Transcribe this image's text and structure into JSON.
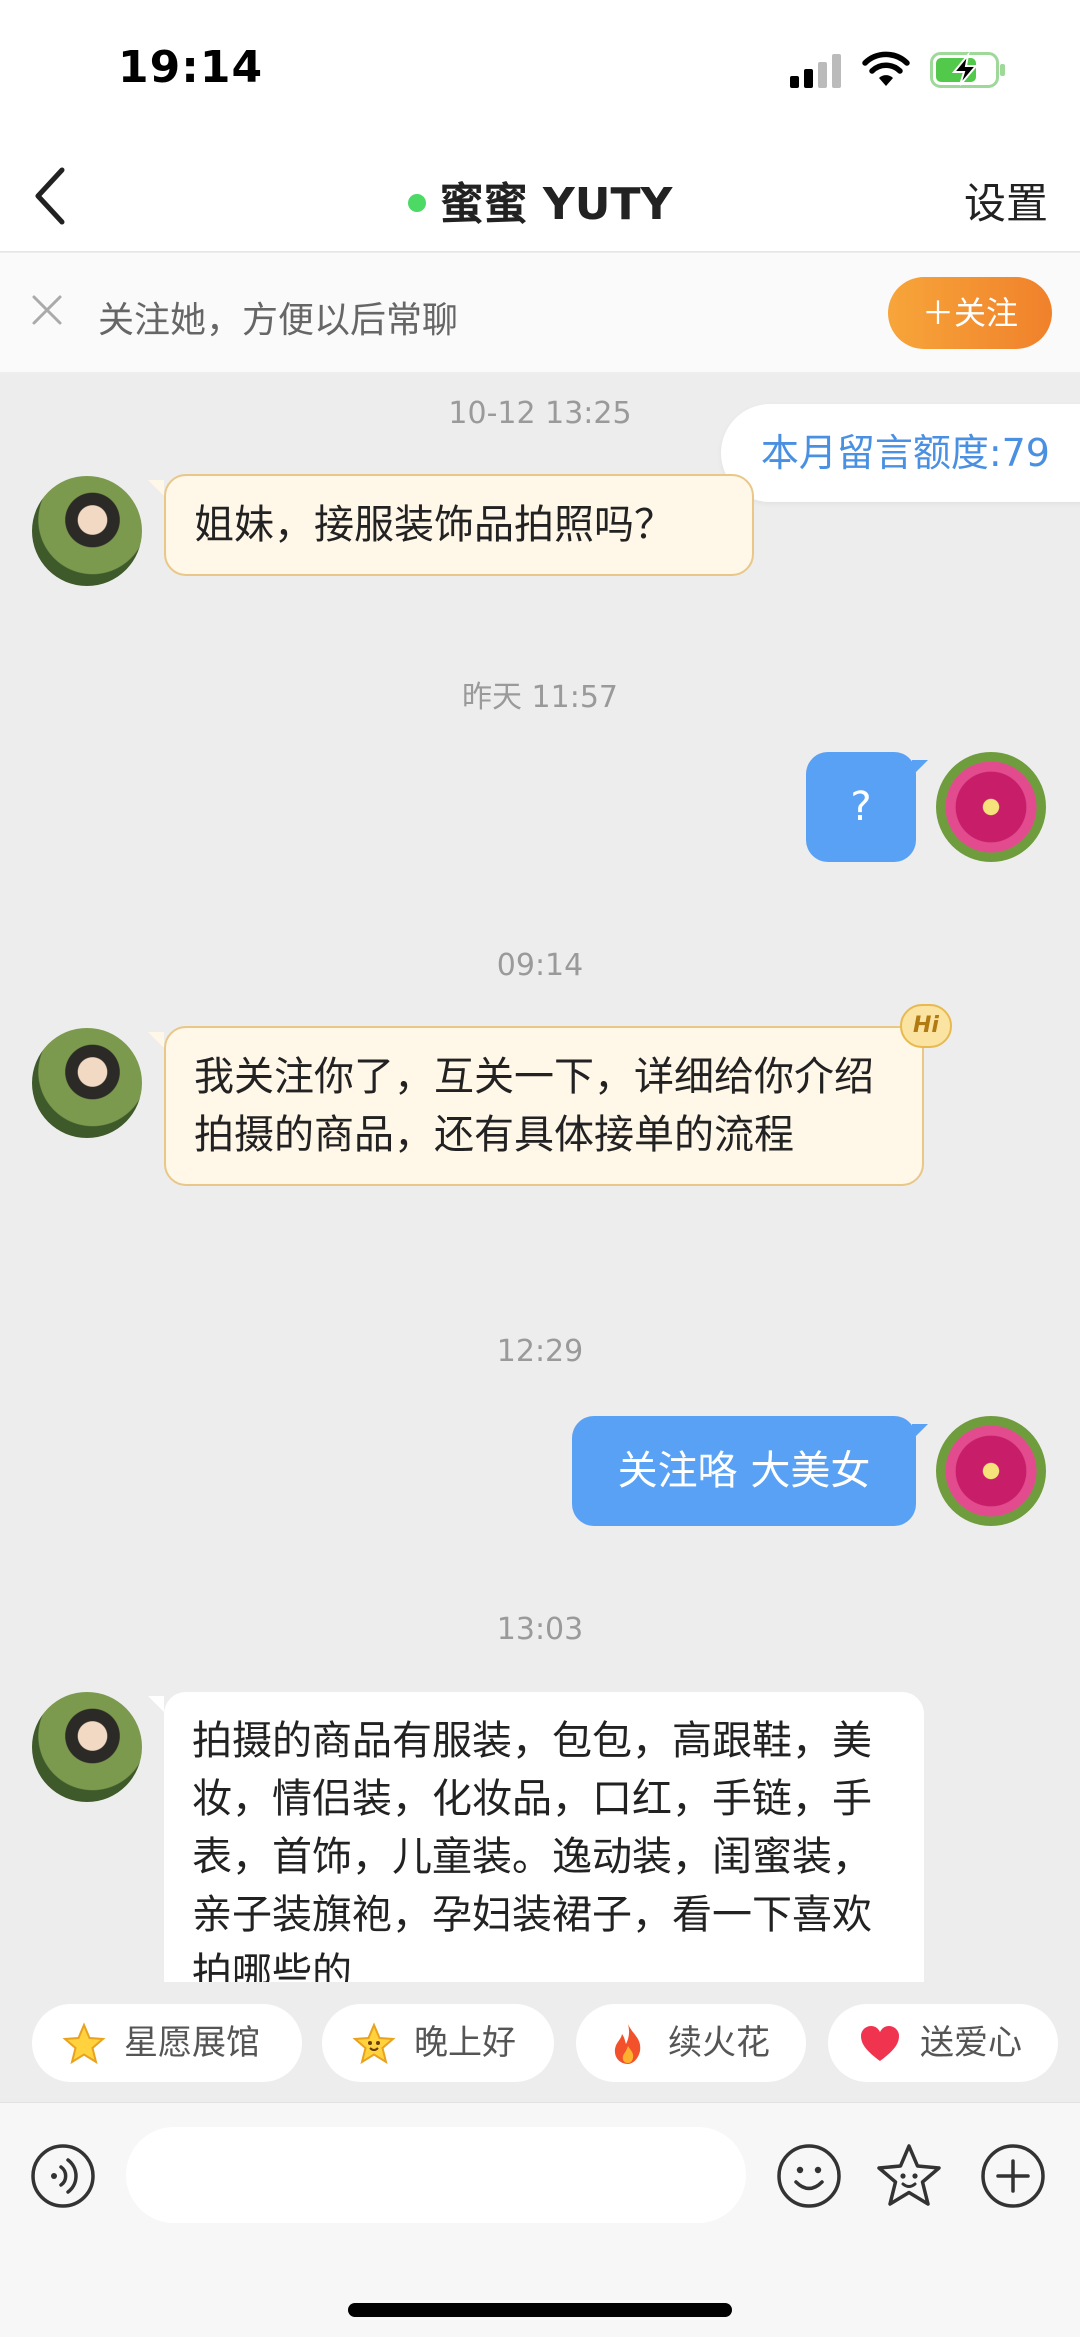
{
  "status": {
    "time": "19:14"
  },
  "header": {
    "name": "蜜蜜 YUTY",
    "settings": "设置"
  },
  "follow_banner": {
    "text": "关注她，方便以后常聊",
    "button": "＋关注"
  },
  "quota": "本月留言额度:79",
  "messages": [
    {
      "time": "10-12 13:25",
      "from": "her",
      "text": "姐妹，接服装饰品拍照吗？"
    },
    {
      "time": "昨天 11:57",
      "from": "me",
      "text": "?"
    },
    {
      "time": "09:14",
      "from": "her",
      "text": "我关注你了，互关一下，详细给你介绍拍摄的商品，还有具体接单的流程",
      "badge": "Hi"
    },
    {
      "time": "12:29",
      "from": "me",
      "text": "关注咯 大美女"
    },
    {
      "time": "13:03",
      "from": "her",
      "text": "拍摄的商品有服装，包包，高跟鞋，美妆，情侣装，化妆品，口红，手链，手表，首饰，儿童装。逸动装，闺蜜装，亲子装旗袍，孕妇装裙子，看一下喜欢拍哪些的"
    }
  ],
  "chips": [
    {
      "label": "星愿展馆",
      "icon": "star-icon"
    },
    {
      "label": "晚上好",
      "icon": "smiling-star-icon"
    },
    {
      "label": "续火花",
      "icon": "fire-icon"
    },
    {
      "label": "送爱心",
      "icon": "heart-icon"
    }
  ],
  "input": {
    "placeholder": ""
  },
  "colors": {
    "accent_blue": "#58a1f5",
    "follow_orange": "#f0812b",
    "online": "#4cd964"
  }
}
